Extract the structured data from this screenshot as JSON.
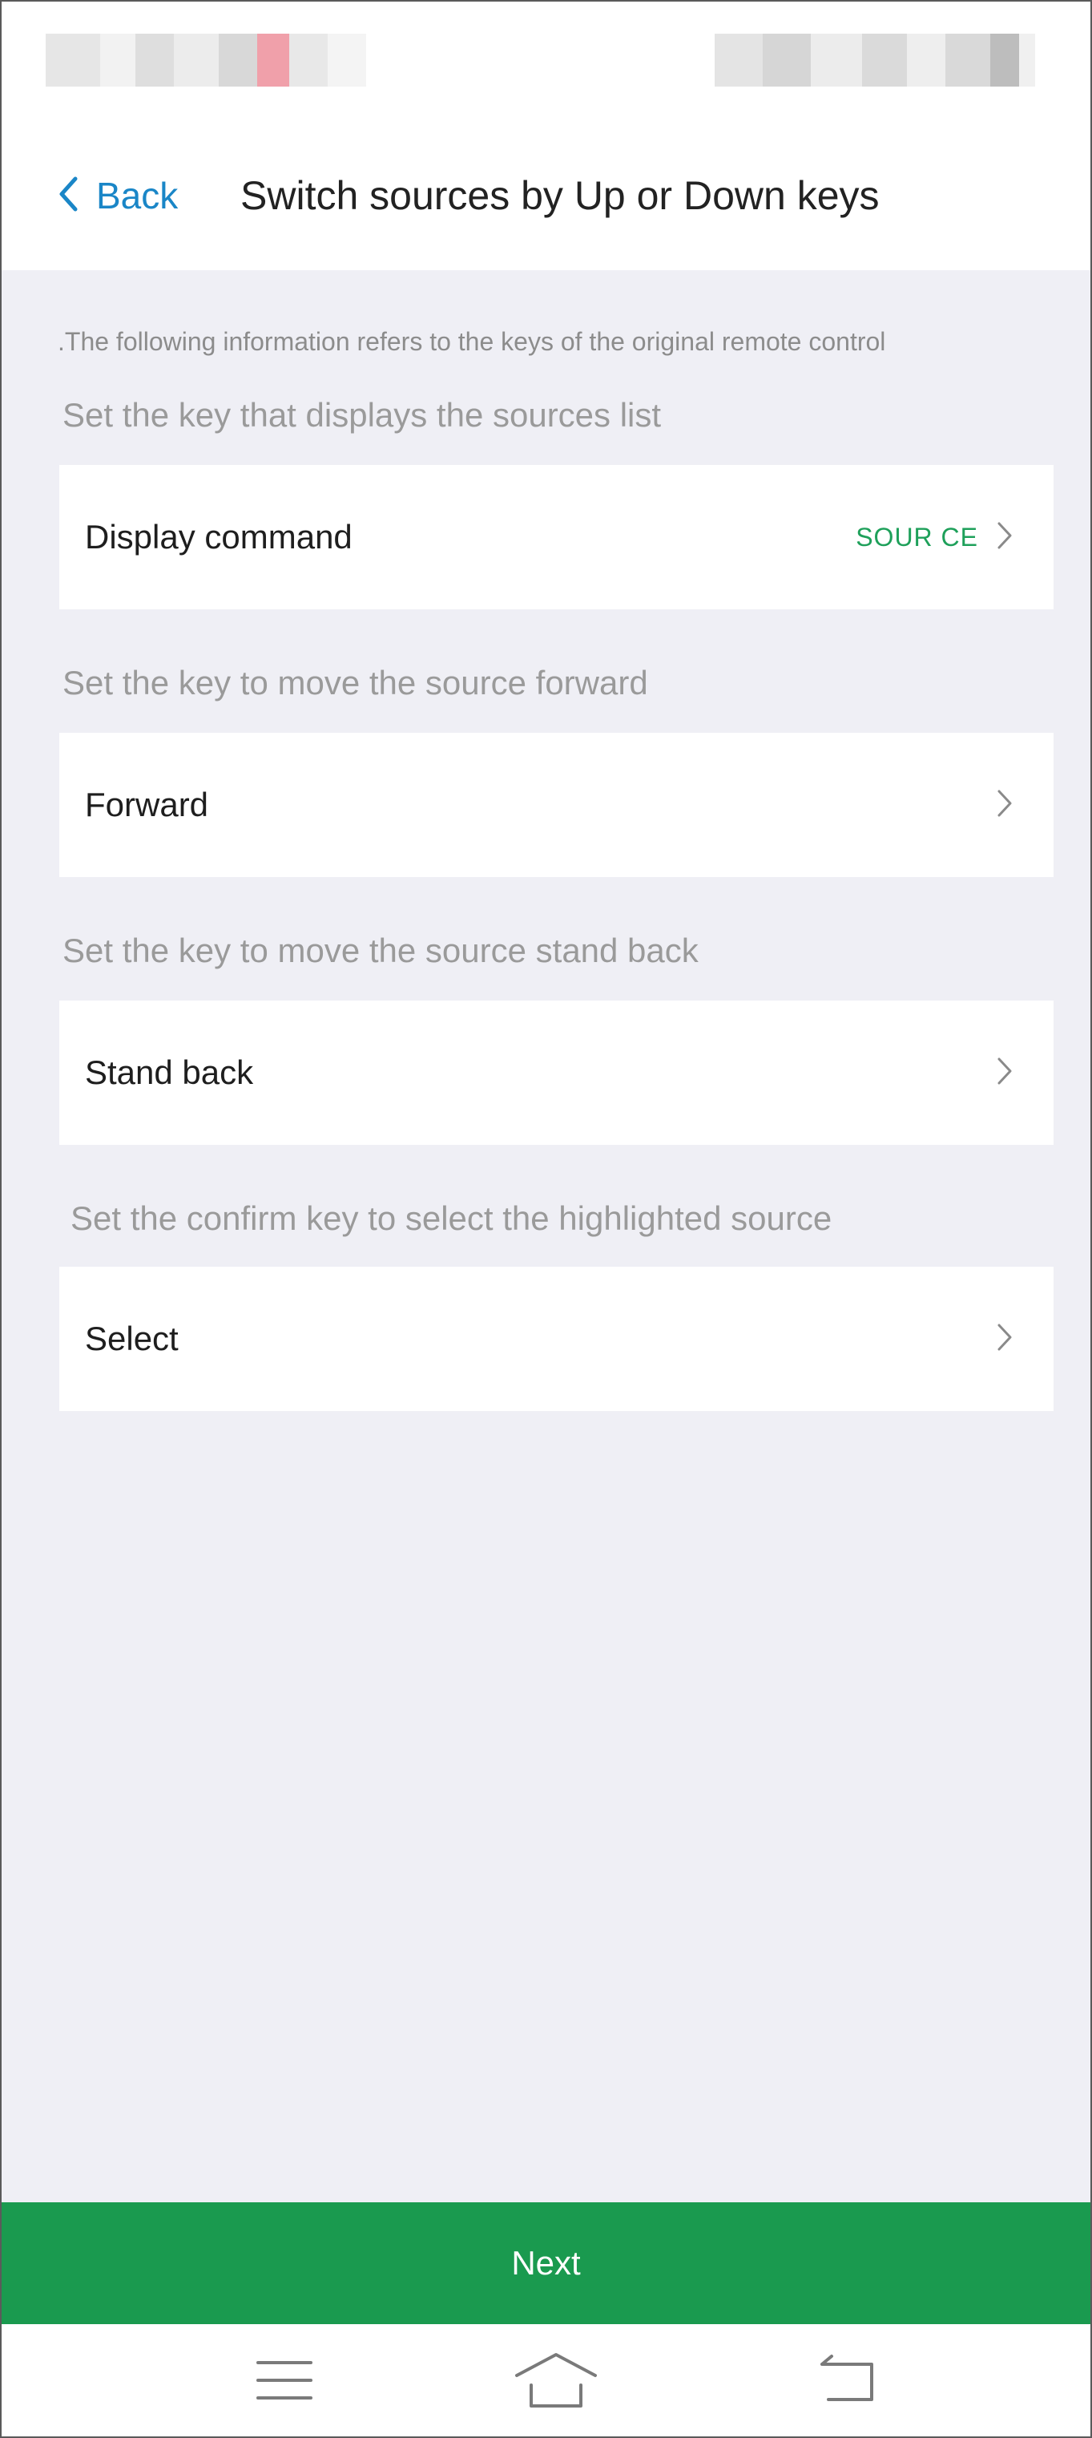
{
  "header": {
    "back_label": "Back",
    "title": "Switch sources by Up or Down keys"
  },
  "info_note": ".The following information refers to the keys of the original remote control",
  "sections": [
    {
      "label": "Set the key that displays the sources list",
      "row_label": "Display command",
      "row_value": "SOUR CE"
    },
    {
      "label": "Set the key to move the source forward",
      "row_label": "Forward",
      "row_value": ""
    },
    {
      "label": "Set the key to move the source stand back",
      "row_label": "Stand back",
      "row_value": ""
    },
    {
      "label": "Set the confirm key to select the highlighted source",
      "row_label": "Select",
      "row_value": ""
    }
  ],
  "footer": {
    "next_label": "Next"
  },
  "nav_icons": [
    "menu-icon",
    "home-icon",
    "return-icon"
  ],
  "colors": {
    "accent_blue": "#1a86c7",
    "value_green": "#1ea05a",
    "next_button_green": "#1a9a4f",
    "page_background": "#efeff5"
  }
}
